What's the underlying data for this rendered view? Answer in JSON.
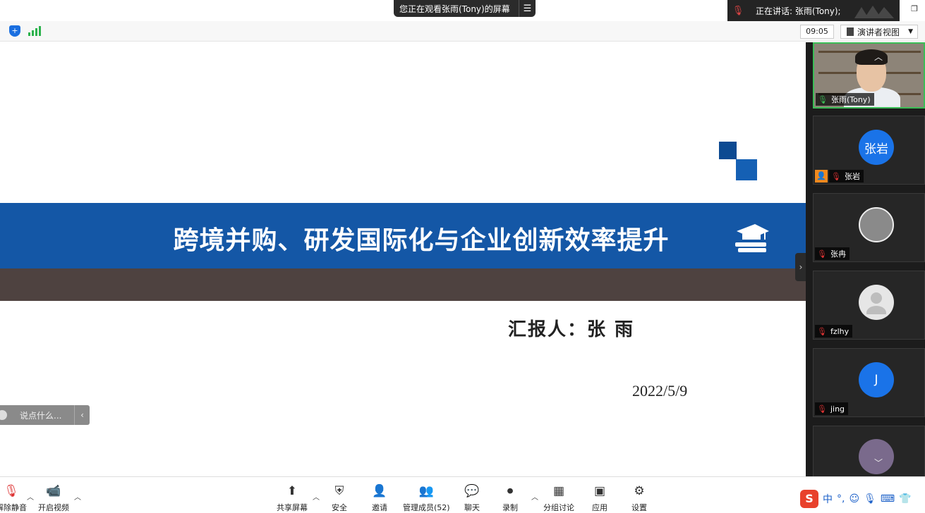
{
  "banner": {
    "viewing_text": "您正在观看张雨(Tony)的屏幕",
    "menu_icon": "list-menu-icon"
  },
  "speaking": {
    "label": "正在讲话: 张雨(Tony);"
  },
  "toolbar": {
    "timer": "09:05",
    "view_label": "演讲者视图"
  },
  "slide": {
    "title": "跨境并购、研发国际化与企业创新效率提升",
    "reporter": "汇报人：张 雨",
    "date": "2022/5/9",
    "colors": {
      "band": "#1457a6",
      "brown": "#4e4240"
    }
  },
  "chat": {
    "placeholder": "说点什么..."
  },
  "participants": [
    {
      "name": "张雨(Tony)",
      "avatar": "",
      "mic": "on",
      "video": true
    },
    {
      "name": "张岩",
      "avatar": "张岩",
      "mic": "muted",
      "host": true,
      "color": "#1a73e8"
    },
    {
      "name": "张冉",
      "avatar": "",
      "mic": "muted",
      "color": "#8a8a8a"
    },
    {
      "name": "fzlhy",
      "avatar": "",
      "mic": "muted",
      "color": "#e0e0e0"
    },
    {
      "name": "jing",
      "avatar": "J",
      "mic": "muted",
      "color": "#1a73e8"
    }
  ],
  "bottom": {
    "mute": "解除静音",
    "video": "开启视频",
    "share": "共享屏幕",
    "security": "安全",
    "invite": "邀请",
    "members": "管理成员(52)",
    "chat": "聊天",
    "record": "录制",
    "breakout": "分组讨论",
    "apps": "应用",
    "settings": "设置"
  },
  "ime": {
    "lang": "中",
    "punct": "°,"
  }
}
